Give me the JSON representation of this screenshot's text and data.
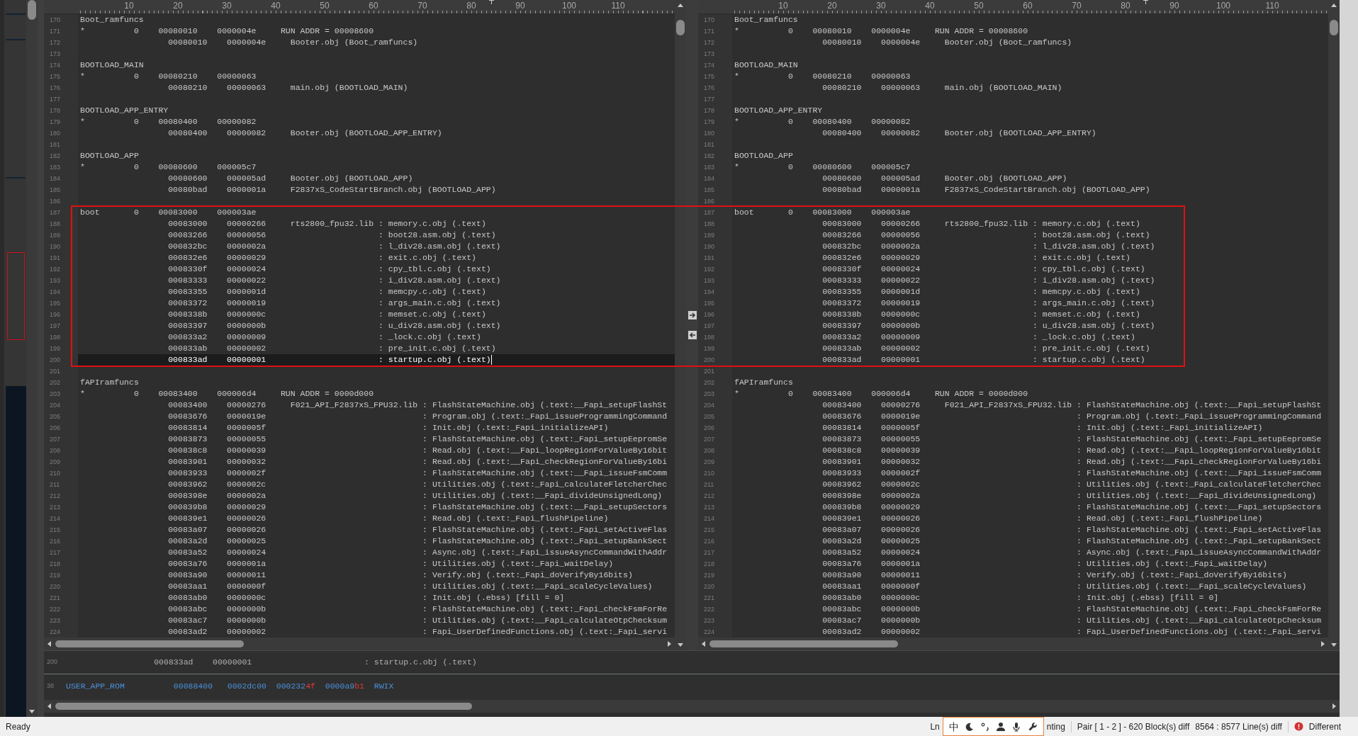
{
  "panes": [
    {
      "ruler_labels": [
        "10",
        "20",
        "30",
        "40",
        "50",
        "60",
        "70",
        "80",
        "90",
        "100",
        "110"
      ],
      "lines": [
        {
          "n": "170",
          "text": "Boot_ramfuncs",
          "current": false
        },
        {
          "n": "171",
          "text": "*          0    00080010    0000004e     RUN ADDR = 00008600",
          "current": false
        },
        {
          "n": "172",
          "text": "                  00080010    0000004e     Booter.obj (Boot_ramfuncs)",
          "current": false
        },
        {
          "n": "173",
          "current": false
        },
        {
          "n": "174",
          "text": "BOOTLOAD_MAIN",
          "current": false
        },
        {
          "n": "175",
          "text": "*          0    00080210    00000063",
          "current": false
        },
        {
          "n": "176",
          "text": "                  00080210    00000063     main.obj (BOOTLOAD_MAIN)",
          "current": false
        },
        {
          "n": "177",
          "current": false
        },
        {
          "n": "178",
          "text": "BOOTLOAD_APP_ENTRY",
          "current": false
        },
        {
          "n": "179",
          "text": "*          0    00080400    00000082",
          "current": false
        },
        {
          "n": "180",
          "text": "                  00080400    00000082     Booter.obj (BOOTLOAD_APP_ENTRY)",
          "current": false
        },
        {
          "n": "181",
          "current": false
        },
        {
          "n": "182",
          "text": "BOOTLOAD_APP",
          "current": false
        },
        {
          "n": "183",
          "text": "*          0    00080600    000005c7",
          "current": false
        },
        {
          "n": "184",
          "text": "                  00080600    000005ad     Booter.obj (BOOTLOAD_APP)",
          "current": false
        },
        {
          "n": "185",
          "text": "                  00080bad    0000001a     F2837xS_CodeStartBranch.obj (BOOTLOAD_APP)",
          "current": false
        },
        {
          "n": "186",
          "current": false
        },
        {
          "n": "187",
          "text": "boot       0    00083000    000003ae",
          "current": false
        },
        {
          "n": "188",
          "text": "                  00083000    00000266     rts2800_fpu32.lib : memory.c.obj (.text)",
          "current": false
        },
        {
          "n": "189",
          "text": "                  00083266    00000056                       : boot28.asm.obj (.text)",
          "current": false
        },
        {
          "n": "190",
          "text": "                  000832bc    0000002a                       : l_div28.asm.obj (.text)",
          "current": false
        },
        {
          "n": "191",
          "text": "                  000832e6    00000029                       : exit.c.obj (.text)",
          "current": false
        },
        {
          "n": "192",
          "text": "                  0008330f    00000024                       : cpy_tbl.c.obj (.text)",
          "current": false
        },
        {
          "n": "193",
          "text": "                  00083333    00000022                       : i_div28.asm.obj (.text)",
          "current": false
        },
        {
          "n": "194",
          "text": "                  00083355    0000001d                       : memcpy.c.obj (.text)",
          "current": false
        },
        {
          "n": "195",
          "text": "                  00083372    00000019                       : args_main.c.obj (.text)",
          "current": false
        },
        {
          "n": "196",
          "text": "                  0008338b    0000000c                       : memset.c.obj (.text)",
          "current": false
        },
        {
          "n": "197",
          "text": "                  00083397    0000000b                       : u_div28.asm.obj (.text)",
          "current": false
        },
        {
          "n": "198",
          "text": "                  000833a2    00000009                       : _lock.c.obj (.text)",
          "current": false
        },
        {
          "n": "199",
          "text": "                  000833ab    00000002                       : pre_init.c.obj (.text)",
          "current": false
        },
        {
          "n": "200",
          "text": "                  000833ad    00000001                       : startup.c.obj (.text)",
          "current": true
        },
        {
          "n": "201",
          "current": false
        },
        {
          "n": "202",
          "text": "fAPIramfuncs",
          "current": false
        },
        {
          "n": "203",
          "text": "*          0    00083400    000006d4     RUN ADDR = 0000d000",
          "current": false
        },
        {
          "n": "204",
          "text": "                  00083400    00000276     F021_API_F2837xS_FPU32.lib : FlashStateMachine.obj (.text:__Fapi_setupFlashSt",
          "current": false
        },
        {
          "n": "205",
          "text": "                  00083676    0000019e                                : Program.obj (.text:_Fapi_issueProgrammingCommand",
          "current": false
        },
        {
          "n": "206",
          "text": "                  00083814    0000005f                                : Init.obj (.text:_Fapi_initializeAPI)",
          "current": false
        },
        {
          "n": "207",
          "text": "                  00083873    00000055                                : FlashStateMachine.obj (.text:_Fapi_setupEepromSe",
          "current": false
        },
        {
          "n": "208",
          "text": "                  000838c8    00000039                                : Read.obj (.text:__Fapi_loopRegionForValueBy16bit",
          "current": false
        },
        {
          "n": "209",
          "text": "                  00083901    00000032                                : Read.obj (.text:__Fapi_checkRegionForValueBy16bi",
          "current": false
        },
        {
          "n": "210",
          "text": "                  00083933    0000002f                                : FlashStateMachine.obj (.text:__Fapi_issueFsmComm",
          "current": false
        },
        {
          "n": "211",
          "text": "                  00083962    0000002c                                : Utilities.obj (.text:_Fapi_calculateFletcherChec",
          "current": false
        },
        {
          "n": "212",
          "text": "                  0008398e    0000002a                                : Utilities.obj (.text:__Fapi_divideUnsignedLong)",
          "current": false
        },
        {
          "n": "213",
          "text": "                  000839b8    00000029                                : FlashStateMachine.obj (.text:__Fapi_setupSectors",
          "current": false
        },
        {
          "n": "214",
          "text": "                  000839e1    00000026                                : Read.obj (.text:_Fapi_flushPipeline)",
          "current": false
        },
        {
          "n": "215",
          "text": "                  00083a07    00000026                                : FlashStateMachine.obj (.text:_Fapi_setActiveFlas",
          "current": false
        },
        {
          "n": "216",
          "text": "                  00083a2d    00000025                                : FlashStateMachine.obj (.text:_Fapi_setupBankSect",
          "current": false
        },
        {
          "n": "217",
          "text": "                  00083a52    00000024                                : Async.obj (.text:_Fapi_issueAsyncCommandWithAddr",
          "current": false
        },
        {
          "n": "218",
          "text": "                  00083a76    0000001a                                : Utilities.obj (.text:_Fapi_waitDelay)",
          "current": false
        },
        {
          "n": "219",
          "text": "                  00083a90    00000011                                : Verify.obj (.text:_Fapi_doVerifyBy16bits)",
          "current": false
        },
        {
          "n": "220",
          "text": "                  00083aa1    0000000f                                : Utilities.obj (.text:__Fapi_scaleCycleValues)",
          "current": false
        },
        {
          "n": "221",
          "text": "                  00083ab0    0000000c                                : Init.obj (.ebss) [fill = 0]",
          "current": false
        },
        {
          "n": "222",
          "text": "                  00083abc    0000000b                                : FlashStateMachine.obj (.text:_Fapi_checkFsmForRe",
          "current": false
        },
        {
          "n": "223",
          "text": "                  00083ac7    0000000b                                : Utilities.obj (.text:__Fapi_calculateOtpChecksum",
          "current": false
        },
        {
          "n": "224",
          "text": "                  00083ad2    00000002                                : Fapi_UserDefinedFunctions.obj (.text:_Fapi_servi",
          "current": false
        }
      ]
    },
    {
      "ruler_labels": [
        "10",
        "20",
        "30",
        "40",
        "50",
        "60",
        "70",
        "80",
        "90",
        "100",
        "110"
      ],
      "lines": [
        {
          "n": "170",
          "text": "Boot_ramfuncs",
          "current": false
        },
        {
          "n": "171",
          "text": "*          0    00080010    0000004e     RUN ADDR = 00008600",
          "current": false
        },
        {
          "n": "172",
          "text": "                  00080010    0000004e     Booter.obj (Boot_ramfuncs)",
          "current": false
        },
        {
          "n": "173",
          "current": false
        },
        {
          "n": "174",
          "text": "BOOTLOAD_MAIN",
          "current": false
        },
        {
          "n": "175",
          "text": "*          0    00080210    00000063",
          "current": false
        },
        {
          "n": "176",
          "text": "                  00080210    00000063     main.obj (BOOTLOAD_MAIN)",
          "current": false
        },
        {
          "n": "177",
          "current": false
        },
        {
          "n": "178",
          "text": "BOOTLOAD_APP_ENTRY",
          "current": false
        },
        {
          "n": "179",
          "text": "*          0    00080400    00000082",
          "current": false
        },
        {
          "n": "180",
          "text": "                  00080400    00000082     Booter.obj (BOOTLOAD_APP_ENTRY)",
          "current": false
        },
        {
          "n": "181",
          "current": false
        },
        {
          "n": "182",
          "text": "BOOTLOAD_APP",
          "current": false
        },
        {
          "n": "183",
          "text": "*          0    00080600    000005c7",
          "current": false
        },
        {
          "n": "184",
          "text": "                  00080600    000005ad     Booter.obj (BOOTLOAD_APP)",
          "current": false
        },
        {
          "n": "185",
          "text": "                  00080bad    0000001a     F2837xS_CodeStartBranch.obj (BOOTLOAD_APP)",
          "current": false
        },
        {
          "n": "186",
          "current": false
        },
        {
          "n": "187",
          "text": "boot       0    00083000    000003ae",
          "current": false
        },
        {
          "n": "188",
          "text": "                  00083000    00000266     rts2800_fpu32.lib : memory.c.obj (.text)",
          "current": false
        },
        {
          "n": "189",
          "text": "                  00083266    00000056                       : boot28.asm.obj (.text)",
          "current": false
        },
        {
          "n": "190",
          "text": "                  000832bc    0000002a                       : l_div28.asm.obj (.text)",
          "current": false
        },
        {
          "n": "191",
          "text": "                  000832e6    00000029                       : exit.c.obj (.text)",
          "current": false
        },
        {
          "n": "192",
          "text": "                  0008330f    00000024                       : cpy_tbl.c.obj (.text)",
          "current": false
        },
        {
          "n": "193",
          "text": "                  00083333    00000022                       : i_div28.asm.obj (.text)",
          "current": false
        },
        {
          "n": "194",
          "text": "                  00083355    0000001d                       : memcpy.c.obj (.text)",
          "current": false
        },
        {
          "n": "195",
          "text": "                  00083372    00000019                       : args_main.c.obj (.text)",
          "current": false
        },
        {
          "n": "196",
          "text": "                  0008338b    0000000c                       : memset.c.obj (.text)",
          "current": false
        },
        {
          "n": "197",
          "text": "                  00083397    0000000b                       : u_div28.asm.obj (.text)",
          "current": false
        },
        {
          "n": "198",
          "text": "                  000833a2    00000009                       : _lock.c.obj (.text)",
          "current": false
        },
        {
          "n": "199",
          "text": "                  000833ab    00000002                       : pre_init.c.obj (.text)",
          "current": false
        },
        {
          "n": "200",
          "text": "                  000833ad    00000001                       : startup.c.obj (.text)",
          "current": false
        },
        {
          "n": "201",
          "current": false
        },
        {
          "n": "202",
          "text": "fAPIramfuncs",
          "current": false
        },
        {
          "n": "203",
          "text": "*          0    00083400    000006d4     RUN ADDR = 0000d000",
          "current": false
        },
        {
          "n": "204",
          "text": "                  00083400    00000276     F021_API_F2837xS_FPU32.lib : FlashStateMachine.obj (.text:__Fapi_setupFlashSt",
          "current": false
        },
        {
          "n": "205",
          "text": "                  00083676    0000019e                                : Program.obj (.text:_Fapi_issueProgrammingCommand",
          "current": false
        },
        {
          "n": "206",
          "text": "                  00083814    0000005f                                : Init.obj (.text:_Fapi_initializeAPI)",
          "current": false
        },
        {
          "n": "207",
          "text": "                  00083873    00000055                                : FlashStateMachine.obj (.text:_Fapi_setupEepromSe",
          "current": false
        },
        {
          "n": "208",
          "text": "                  000838c8    00000039                                : Read.obj (.text:__Fapi_loopRegionForValueBy16bit",
          "current": false
        },
        {
          "n": "209",
          "text": "                  00083901    00000032                                : Read.obj (.text:__Fapi_checkRegionForValueBy16bi",
          "current": false
        },
        {
          "n": "210",
          "text": "                  00083933    0000002f                                : FlashStateMachine.obj (.text:__Fapi_issueFsmComm",
          "current": false
        },
        {
          "n": "211",
          "text": "                  00083962    0000002c                                : Utilities.obj (.text:_Fapi_calculateFletcherChec",
          "current": false
        },
        {
          "n": "212",
          "text": "                  0008398e    0000002a                                : Utilities.obj (.text:__Fapi_divideUnsignedLong)",
          "current": false
        },
        {
          "n": "213",
          "text": "                  000839b8    00000029                                : FlashStateMachine.obj (.text:__Fapi_setupSectors",
          "current": false
        },
        {
          "n": "214",
          "text": "                  000839e1    00000026                                : Read.obj (.text:_Fapi_flushPipeline)",
          "current": false
        },
        {
          "n": "215",
          "text": "                  00083a07    00000026                                : FlashStateMachine.obj (.text:_Fapi_setActiveFlas",
          "current": false
        },
        {
          "n": "216",
          "text": "                  00083a2d    00000025                                : FlashStateMachine.obj (.text:_Fapi_setupBankSect",
          "current": false
        },
        {
          "n": "217",
          "text": "                  00083a52    00000024                                : Async.obj (.text:_Fapi_issueAsyncCommandWithAddr",
          "current": false
        },
        {
          "n": "218",
          "text": "                  00083a76    0000001a                                : Utilities.obj (.text:_Fapi_waitDelay)",
          "current": false
        },
        {
          "n": "219",
          "text": "                  00083a90    00000011                                : Verify.obj (.text:_Fapi_doVerifyBy16bits)",
          "current": false
        },
        {
          "n": "220",
          "text": "                  00083aa1    0000000f                                : Utilities.obj (.text:__Fapi_scaleCycleValues)",
          "current": false
        },
        {
          "n": "221",
          "text": "                  00083ab0    0000000c                                : Init.obj (.ebss) [fill = 0]",
          "current": false
        },
        {
          "n": "222",
          "text": "                  00083abc    0000000b                                : FlashStateMachine.obj (.text:_Fapi_checkFsmForRe",
          "current": false
        },
        {
          "n": "223",
          "text": "                  00083ac7    0000000b                                : Utilities.obj (.text:__Fapi_calculateOtpChecksum",
          "current": false
        },
        {
          "n": "224",
          "text": "                  00083ad2    00000002                                : Fapi_UserDefinedFunctions.obj (.text:_Fapi_servi",
          "current": false
        }
      ]
    }
  ],
  "annotation": {
    "kind": "rectangle"
  },
  "detail_panel": {
    "lines": [
      {
        "n": "200",
        "segments": [
          {
            "text": "                  000833ad    00000001                       : startup.c.obj (.text)",
            "kind": "plain"
          }
        ]
      },
      {
        "n": "38",
        "segments": [
          {
            "text": "USER_APP_ROM          00088400   0002dc00  000232",
            "kind": "match"
          },
          {
            "text": "4f",
            "kind": "diff"
          },
          {
            "text": "  0000a9",
            "kind": "match"
          },
          {
            "text": "b1",
            "kind": "diff"
          },
          {
            "text": "  RWIX",
            "kind": "match"
          }
        ]
      }
    ]
  },
  "status_bar": {
    "message": "Ready",
    "partial_left": "Ln",
    "ime_toolbar": {
      "glyph": "中"
    },
    "partial_right": "nting",
    "pair": "Pair [ 1 - 2 ] - 620 Block(s) diff",
    "line_diff": "8564 : 8577 Line(s) diff",
    "result": {
      "kind": "error",
      "text": "Different"
    }
  }
}
